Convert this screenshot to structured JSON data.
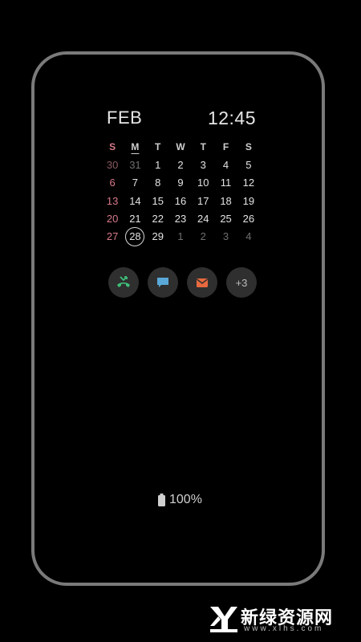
{
  "clock": {
    "month": "FEB",
    "time": "12:45"
  },
  "calendar": {
    "weekdays": [
      "S",
      "M",
      "T",
      "W",
      "T",
      "F",
      "S"
    ],
    "weeks": [
      [
        "30",
        "31",
        "1",
        "2",
        "3",
        "4",
        "5"
      ],
      [
        "6",
        "7",
        "8",
        "9",
        "10",
        "11",
        "12"
      ],
      [
        "13",
        "14",
        "15",
        "16",
        "17",
        "18",
        "19"
      ],
      [
        "20",
        "21",
        "22",
        "23",
        "24",
        "25",
        "26"
      ],
      [
        "27",
        "28",
        "29",
        "1",
        "2",
        "3",
        "4"
      ]
    ],
    "today": "28"
  },
  "notifications": {
    "icons": [
      "missed-call-icon",
      "message-icon",
      "email-icon"
    ],
    "colors": {
      "missed_call": "#3ec07a",
      "message": "#5aa8d8",
      "email": "#e86a3e"
    },
    "more_label": "+3"
  },
  "battery": {
    "label": "100%",
    "level": 1.0
  },
  "watermark": {
    "title": "新绿资源网",
    "subtitle": "www.xlhs.com"
  }
}
